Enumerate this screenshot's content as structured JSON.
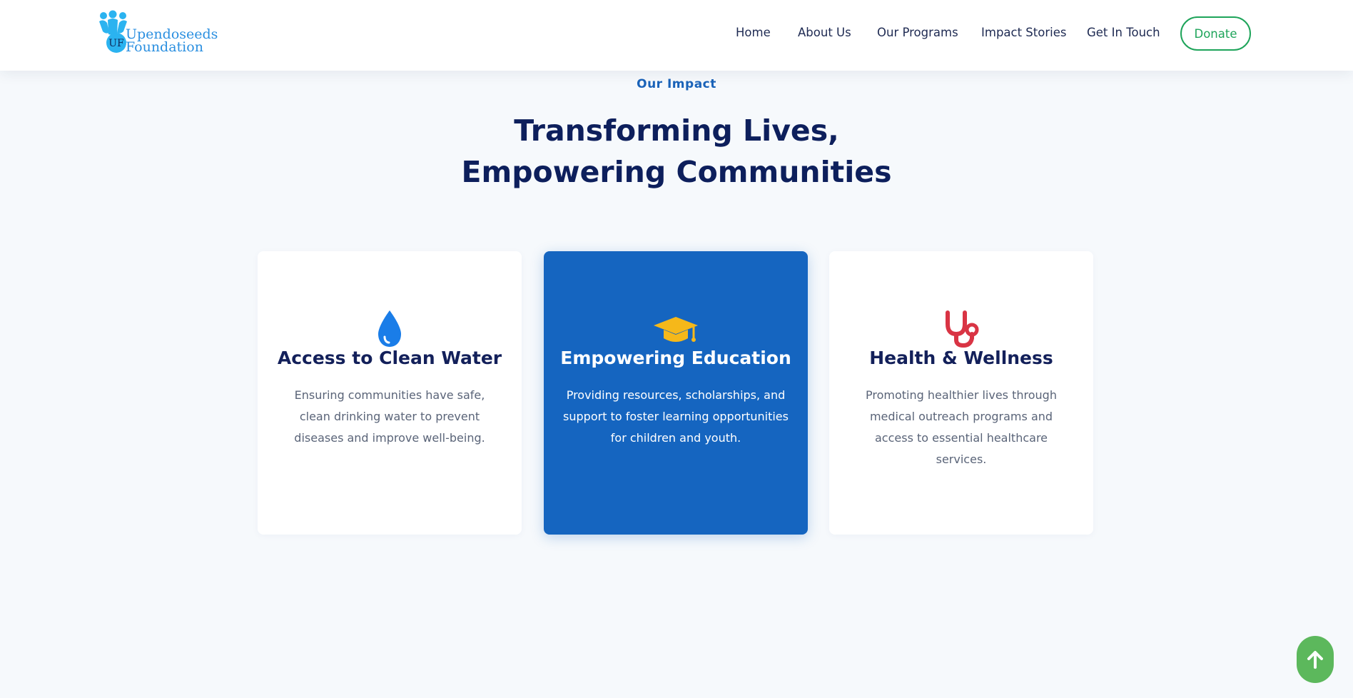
{
  "brand": {
    "name_line1": "Upendoseeds",
    "name_line2": "Foundation",
    "monogram": "UF",
    "color": "#2a8fe0"
  },
  "nav": {
    "items": [
      {
        "label": "Home"
      },
      {
        "label": "About Us"
      },
      {
        "label": "Our Programs"
      },
      {
        "label": "Impact Stories"
      },
      {
        "label": "Get In Touch"
      }
    ],
    "donate_label": "Donate",
    "donate_color": "#1ea45a"
  },
  "section": {
    "eyebrow": "Our Impact",
    "title_line1": "Transforming Lives,",
    "title_line2": "Empowering Communities"
  },
  "cards": [
    {
      "icon": "water-drop-icon",
      "title": "Access to Clean Water",
      "description": "Ensuring communities have safe, clean drinking water to prevent diseases and improve well-being."
    },
    {
      "icon": "graduation-cap-icon",
      "title": "Empowering Education",
      "description": "Providing resources, scholarships, and support to foster learning opportunities for children and youth.",
      "highlight_color": "#1565c0"
    },
    {
      "icon": "stethoscope-icon",
      "title": "Health & Wellness",
      "description": "Promoting healthier lives through medical outreach programs and access to essential healthcare services."
    }
  ],
  "scroll_top": {
    "icon": "arrow-up-icon",
    "color": "#5cb85c"
  }
}
